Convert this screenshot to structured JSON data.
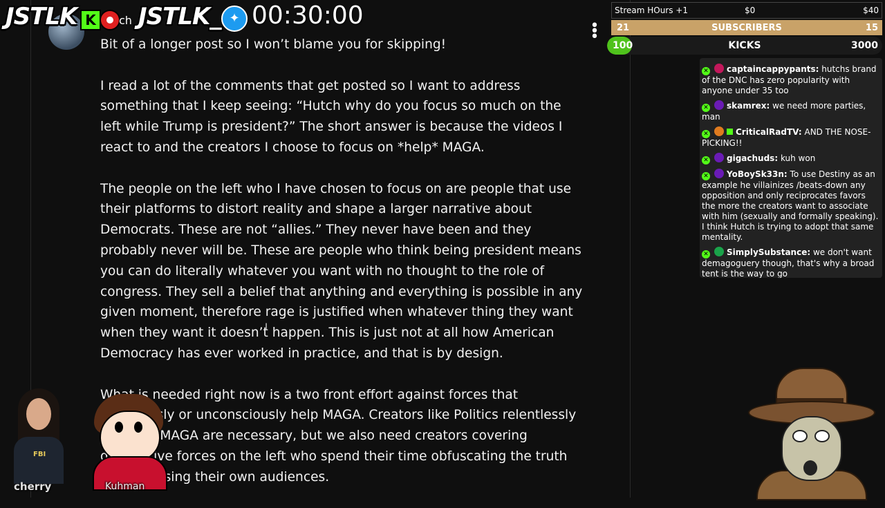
{
  "header": {
    "brand_left": "JSTLK",
    "kick_letter": "K",
    "partial_text": "ch",
    "brand_right": "JSTLK_",
    "timer": "00:30:00"
  },
  "goals": {
    "stream": {
      "label": "Stream HOurs +1",
      "mid": "$0",
      "right": "$40"
    },
    "subscribers": {
      "left": "21",
      "label": "SUBSCRIBERS",
      "right": "15"
    },
    "kicks": {
      "left": "100",
      "label": "KICKS",
      "right": "3000",
      "progress": 0.033
    }
  },
  "post": {
    "paragraphs": [
      "Bit of a longer post so I won’t blame you for skipping!",
      "I read a lot of the comments that get posted so I want to address something that I keep seeing: “Hutch why do you focus so much on the left while Trump is president?” The short answer is because the videos I react to and the creators I choose to focus on *help* MAGA.",
      "The people on the left who I have chosen to focus on are people that use their platforms to distort reality and shape a larger narrative about Democrats. These are not “allies.” They never have been and they probably never will be. These are people who think being president means you can do literally whatever you want with no thought to the role of congress. They sell a belief that anything and everything is possible in any given moment, therefore rage is justified when whatever thing they want when they want it doesn’t happen. This is just not at all how American Democracy has ever worked in practice, and that is by design.",
      "What is needed right now is a two front effort against forces that consciously or unconsciously help MAGA. Creators like Politics relentlessly covering MAGA are necessary, but we also need creators covering destructive forces on the left who spend their time obfuscating the truth and confusing their own audiences."
    ]
  },
  "chat": {
    "messages": [
      {
        "user": "captaincappypants:",
        "text": " hutchs brand of the DNC has zero popularity with anyone under 35 too",
        "color": "#c2185b"
      },
      {
        "user": "skamrex:",
        "text": " we need more parties, man",
        "color": "#6a1bb5"
      },
      {
        "user": "CriticalRadTV:",
        "text": " AND THE NOSE-PICKING!!",
        "color": "#e07b1f"
      },
      {
        "user": "gigachuds:",
        "text": " kuh won",
        "color": "#6a1bb5"
      },
      {
        "user": "YoBoySk33n:",
        "text": " To use Destiny as an example he villainizes /beats-down any opposition and only reciprocates favors the more the creators want to associate with him (sexually and formally speaking). I think Hutch is trying to adopt that same mentality.",
        "color": "#6a1bb5"
      },
      {
        "user": "SimplySubstance:",
        "text": " we don't want demagoguery though, that's why a broad tent is the way to go",
        "color": "#1aa34a"
      }
    ]
  },
  "overlays": {
    "cherry_label": "cherry",
    "kuhman_label": "Kuhman",
    "fbi_text": "FBI"
  }
}
